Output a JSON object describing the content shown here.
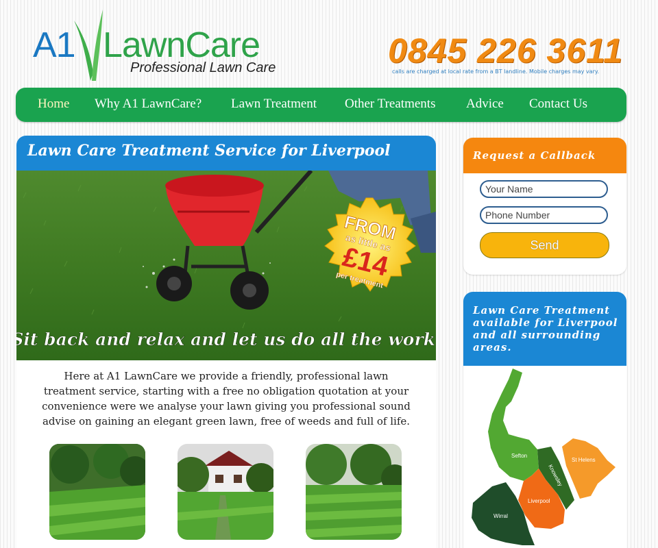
{
  "header": {
    "logo_a1": "A1",
    "logo_lawncare": "LawnCare",
    "logo_tagline": "Professional Lawn Care",
    "phone": "0845 226 3611",
    "phone_note": "calls are charged at local rate from a BT landline. Mobile charges may vary."
  },
  "nav": {
    "items": [
      {
        "label": "Home",
        "active": true
      },
      {
        "label": "Why A1 LawnCare?"
      },
      {
        "label": "Lawn Treatment"
      },
      {
        "label": "Other Treatments"
      },
      {
        "label": "Advice"
      },
      {
        "label": "Contact Us"
      }
    ]
  },
  "main": {
    "title": "Lawn Care Treatment Service for Liverpool",
    "hero": {
      "badge_from": "FROM",
      "badge_as_little_as": "as little as",
      "badge_price": "£14",
      "badge_per": "per treatment",
      "caption": "Sit back and relax and let us do all the work."
    },
    "intro": "Here at A1 LawnCare we provide a friendly, professional lawn treatment service, starting with a free no obligation quotation at your convenience were we analyse your lawn giving you professional sound advise on gaining an elegant green lawn, free of weeds and full of life."
  },
  "callback": {
    "title": "Request a Callback",
    "name_placeholder": "Your Name",
    "phone_placeholder": "Phone Number",
    "send_label": "Send"
  },
  "area": {
    "title": "Lawn Care Treatment available for Liverpool and all surrounding areas.",
    "map_labels": {
      "sefton": "Sefton",
      "knowsley": "Knowsley",
      "st_helens": "St Helens",
      "liverpool": "Liverpool",
      "wirral": "Wirral"
    }
  },
  "colors": {
    "brand_blue": "#1b87d4",
    "brand_green": "#1aa34f",
    "brand_orange": "#f5870f",
    "phone_orange": "#f08a13",
    "send_yellow": "#f8b40c"
  }
}
